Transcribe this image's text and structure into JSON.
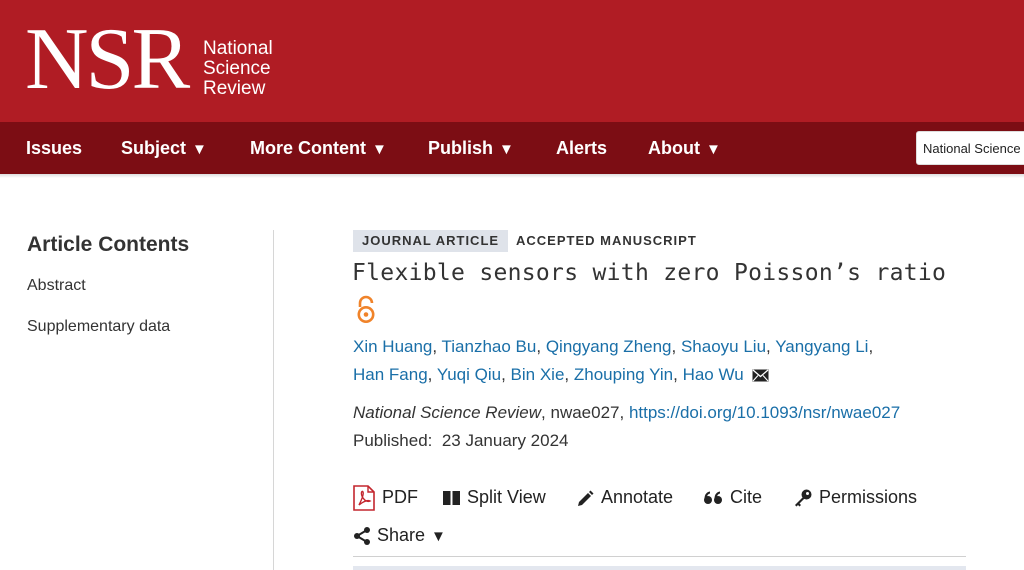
{
  "header": {
    "logo_mark": "NSR",
    "logo_words": [
      "National",
      "Science",
      "Review"
    ]
  },
  "nav": {
    "items": [
      {
        "label": "Issues",
        "dropdown": false
      },
      {
        "label": "Subject",
        "dropdown": true
      },
      {
        "label": "More Content",
        "dropdown": true
      },
      {
        "label": "Publish",
        "dropdown": true
      },
      {
        "label": "Alerts",
        "dropdown": false
      },
      {
        "label": "About",
        "dropdown": true
      }
    ],
    "search_value": "National Science Review"
  },
  "sidebar": {
    "title": "Article Contents",
    "items": [
      "Abstract",
      "Supplementary data"
    ]
  },
  "article": {
    "type_badge": "JOURNAL ARTICLE",
    "status": "ACCEPTED MANUSCRIPT",
    "title": "Flexible sensors with zero Poisson’s ratio",
    "authors_line1": [
      "Xin Huang",
      "Tianzhao Bu",
      "Qingyang Zheng",
      "Shaoyu Liu",
      "Yangyang Li"
    ],
    "authors_line2": [
      "Han Fang",
      "Yuqi Qiu",
      "Bin Xie",
      "Zhouping Yin",
      "Hao Wu"
    ],
    "journal": "National Science Review",
    "article_id": ", nwae027, ",
    "doi": "https://doi.org/10.1093/nsr/nwae027",
    "published_label": "Published:",
    "published_date": "23 January 2024"
  },
  "toolbar": {
    "pdf": "PDF",
    "split_view": "Split View",
    "annotate": "Annotate",
    "cite": "Cite",
    "permissions": "Permissions",
    "share": "Share"
  },
  "colors": {
    "brand_red": "#b01c24",
    "nav_dark_red": "#7c0d14",
    "link_blue": "#1a6fa8",
    "open_access_orange": "#f0832a"
  }
}
